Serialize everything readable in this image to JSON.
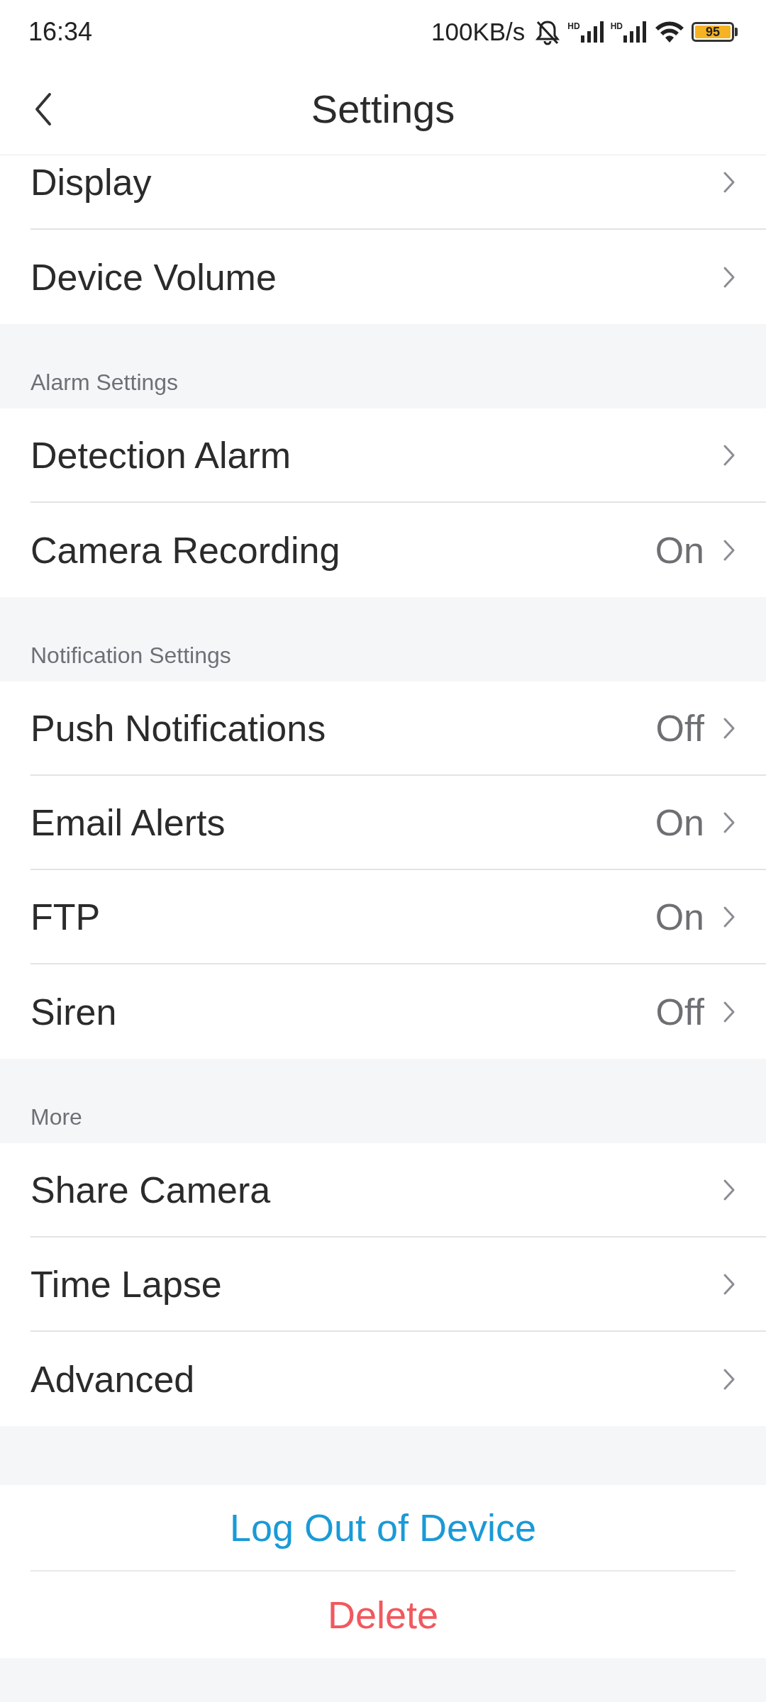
{
  "status_bar": {
    "time": "16:34",
    "speed": "100KB/s",
    "signal_labels": [
      "HD",
      "HD"
    ],
    "battery": "95"
  },
  "header": {
    "title": "Settings"
  },
  "sections": [
    {
      "items": [
        {
          "label": "Display"
        },
        {
          "label": "Device Volume"
        }
      ]
    },
    {
      "title": "Alarm Settings",
      "items": [
        {
          "label": "Detection Alarm"
        },
        {
          "label": "Camera Recording",
          "value": "On"
        }
      ]
    },
    {
      "title": "Notification Settings",
      "items": [
        {
          "label": "Push Notifications",
          "value": "Off"
        },
        {
          "label": "Email Alerts",
          "value": "On"
        },
        {
          "label": "FTP",
          "value": "On"
        },
        {
          "label": "Siren",
          "value": "Off"
        }
      ]
    },
    {
      "title": "More",
      "items": [
        {
          "label": "Share Camera"
        },
        {
          "label": "Time Lapse"
        },
        {
          "label": "Advanced"
        }
      ]
    }
  ],
  "actions": [
    {
      "label": "Log Out of Device",
      "kind": "primary"
    },
    {
      "label": "Delete",
      "kind": "danger"
    }
  ]
}
